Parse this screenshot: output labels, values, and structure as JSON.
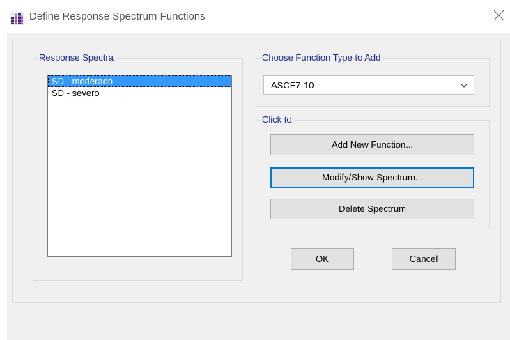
{
  "window": {
    "title": "Define Response Spectrum Functions"
  },
  "response_spectra": {
    "label": "Response Spectra",
    "items": [
      {
        "label": "SD - moderado",
        "selected": true
      },
      {
        "label": "SD - severo",
        "selected": false
      }
    ]
  },
  "function_type": {
    "label": "Choose  Function Type to Add",
    "selected_value": "ASCE7-10"
  },
  "click_to": {
    "label": "Click to:",
    "add_button": "Add New Function...",
    "modify_button": "Modify/Show Spectrum...",
    "delete_button": "Delete Spectrum"
  },
  "footer": {
    "ok_label": "OK",
    "cancel_label": "Cancel"
  },
  "colors": {
    "selection": "#3399ff",
    "group_label": "#1c2a8c",
    "focus_border": "#0078d7"
  },
  "icons": {
    "app": "app-grid-icon",
    "close": "close-icon",
    "dropdown": "chevron-down-icon"
  }
}
